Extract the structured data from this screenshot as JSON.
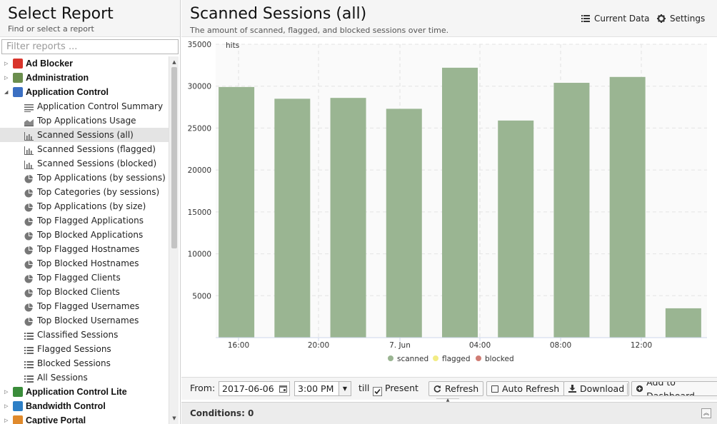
{
  "sidebar": {
    "title": "Select Report",
    "subtitle": "Find or select a report",
    "filter_placeholder": "Filter reports ...",
    "categories": [
      {
        "label": "Ad Blocker",
        "expanded": false,
        "icon": "ad-blocker-icon",
        "color": "#d9342b"
      },
      {
        "label": "Administration",
        "expanded": false,
        "icon": "administration-icon",
        "color": "#6b8e4e"
      },
      {
        "label": "Application Control",
        "expanded": true,
        "icon": "application-control-icon",
        "color": "#3b6fc2"
      },
      {
        "label": "Application Control Lite",
        "expanded": false,
        "icon": "application-control-lite-icon",
        "color": "#3a8c3a"
      },
      {
        "label": "Bandwidth Control",
        "expanded": false,
        "icon": "bandwidth-control-icon",
        "color": "#2d7fc6"
      },
      {
        "label": "Captive Portal",
        "expanded": false,
        "icon": "captive-portal-icon",
        "color": "#e08a2c"
      }
    ],
    "reports": [
      {
        "label": "Application Control Summary",
        "icon": "text-report-icon"
      },
      {
        "label": "Top Applications Usage",
        "icon": "area-chart-icon"
      },
      {
        "label": "Scanned Sessions (all)",
        "icon": "bar-chart-icon",
        "selected": true
      },
      {
        "label": "Scanned Sessions (flagged)",
        "icon": "bar-chart-icon"
      },
      {
        "label": "Scanned Sessions (blocked)",
        "icon": "bar-chart-icon"
      },
      {
        "label": "Top Applications (by sessions)",
        "icon": "pie-chart-icon"
      },
      {
        "label": "Top Categories (by sessions)",
        "icon": "pie-chart-icon"
      },
      {
        "label": "Top Applications (by size)",
        "icon": "pie-chart-icon"
      },
      {
        "label": "Top Flagged Applications",
        "icon": "pie-chart-icon"
      },
      {
        "label": "Top Blocked Applications",
        "icon": "pie-chart-icon"
      },
      {
        "label": "Top Flagged Hostnames",
        "icon": "pie-chart-icon"
      },
      {
        "label": "Top Blocked Hostnames",
        "icon": "pie-chart-icon"
      },
      {
        "label": "Top Flagged Clients",
        "icon": "pie-chart-icon"
      },
      {
        "label": "Top Blocked Clients",
        "icon": "pie-chart-icon"
      },
      {
        "label": "Top Flagged Usernames",
        "icon": "pie-chart-icon"
      },
      {
        "label": "Top Blocked Usernames",
        "icon": "pie-chart-icon"
      },
      {
        "label": "Classified Sessions",
        "icon": "list-icon"
      },
      {
        "label": "Flagged Sessions",
        "icon": "list-icon"
      },
      {
        "label": "Blocked Sessions",
        "icon": "list-icon"
      },
      {
        "label": "All Sessions",
        "icon": "list-icon"
      }
    ]
  },
  "header": {
    "title": "Scanned Sessions (all)",
    "subtitle": "The amount of scanned, flagged, and blocked sessions over time.",
    "current_data_label": "Current Data",
    "settings_label": "Settings"
  },
  "chart_data": {
    "type": "bar",
    "ylabel": "hits",
    "ylim": [
      0,
      35000
    ],
    "yticks": [
      5000,
      10000,
      15000,
      20000,
      25000,
      30000,
      35000
    ],
    "xticks": [
      "16:00",
      "20:00",
      "7. Jun",
      "04:00",
      "08:00",
      "12:00"
    ],
    "grid": true,
    "legend_position": "bottom",
    "colors": {
      "scanned": "#9ab592",
      "flagged": "#f2ec84",
      "blocked": "#d07c74"
    },
    "series": [
      {
        "name": "scanned",
        "values": [
          29900,
          28500,
          28600,
          27300,
          32200,
          25900,
          30400,
          31100,
          3500
        ]
      },
      {
        "name": "flagged",
        "values": [
          0,
          0,
          0,
          0,
          0,
          0,
          0,
          0,
          0
        ]
      },
      {
        "name": "blocked",
        "values": [
          0,
          0,
          0,
          0,
          0,
          0,
          0,
          0,
          0
        ]
      }
    ]
  },
  "toolbar": {
    "from_label": "From:",
    "from_date": "2017-06-06",
    "from_time": "3:00 PM",
    "till_label": "till",
    "present_label": "Present",
    "present_checked": true,
    "refresh_label": "Refresh",
    "auto_refresh_label": "Auto Refresh",
    "download_label": "Download",
    "add_dashboard_label": "Add to Dashboard"
  },
  "conditions": {
    "label": "Conditions: 0"
  }
}
